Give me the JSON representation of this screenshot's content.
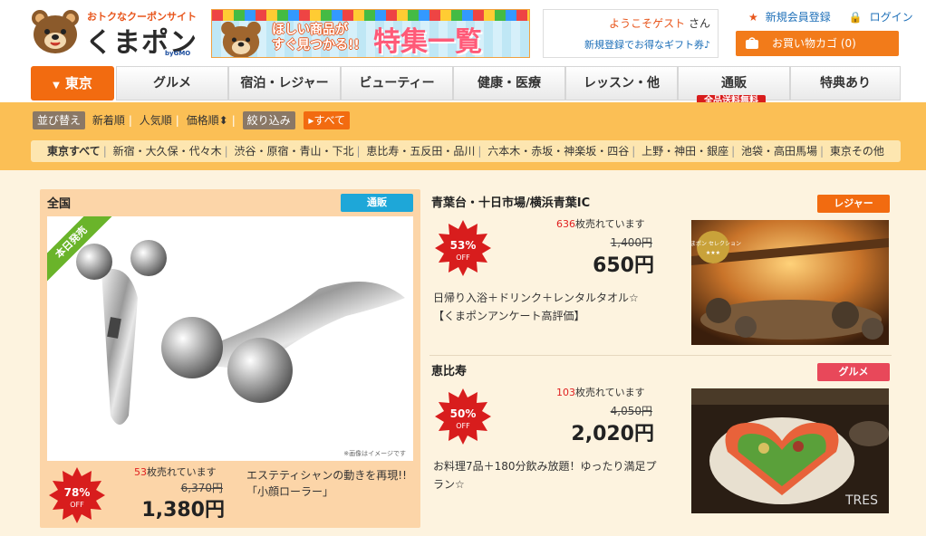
{
  "header": {
    "logo": {
      "tagline": "おトクなクーポンサイト",
      "brand": "くまポン",
      "by": "byGMO"
    },
    "banner": {
      "line1": "ほしい商品が",
      "line2": "すぐ見つかる!!",
      "main": "特集一覧"
    },
    "welcome": {
      "greeting": "ようこそゲスト",
      "suffix": "さん",
      "gift": "新規登録でお得なギフト券♪"
    },
    "links": {
      "register": "新規会員登録",
      "login": "ログイン"
    },
    "cart": {
      "label": "お買い物カゴ (0)"
    }
  },
  "nav": {
    "area": "東京",
    "tabs": [
      "グルメ",
      "宿泊・レジャー",
      "ビューティー",
      "健康・医療",
      "レッスン・他",
      "通販",
      "特典あり"
    ],
    "badge": "全品送料無料"
  },
  "filters": {
    "sort_label": "並び替え",
    "sorts": [
      "新着順",
      "人気順",
      "価格順"
    ],
    "narrow_label": "絞り込み",
    "all_label": "すべて",
    "areas": [
      "東京すべて",
      "新宿・大久保・代々木",
      "渋谷・原宿・青山・下北",
      "恵比寿・五反田・品川",
      "六本木・赤坂・神楽坂・四谷",
      "上野・神田・銀座",
      "池袋・高田馬場",
      "東京その他"
    ]
  },
  "deals": {
    "featured": {
      "region": "全国",
      "category": "通販",
      "ribbon": "本日発売",
      "note": "※画像はイメージです",
      "discount": "78%",
      "off": "OFF",
      "sold_count": "53",
      "sold_suffix": "枚売れています",
      "original_price": "6,370円",
      "price": "1,380円",
      "description": "エステティシャンの動きを再現!!「小顔ローラー」",
      "colors": {
        "tag": "#1ea7d8"
      }
    },
    "items": [
      {
        "region": "青葉台・十日市場/横浜青葉IC",
        "category": "レジャー",
        "discount": "53%",
        "off": "OFF",
        "sold_count": "636",
        "sold_suffix": "枚売れています",
        "original_price": "1,400円",
        "price": "650円",
        "description": "日帰り入浴＋ドリンク＋レンタルタオル☆【くまポンアンケート高評価】",
        "seal": "くまポン セレクション",
        "colors": {
          "tag": "#f26b10"
        }
      },
      {
        "region": "恵比寿",
        "category": "グルメ",
        "discount": "50%",
        "off": "OFF",
        "sold_count": "103",
        "sold_suffix": "枚売れています",
        "original_price": "4,050円",
        "price": "2,020円",
        "description": "お料理7品＋180分飲み放題！ゆったり満足プラン☆",
        "sign": "TRES",
        "colors": {
          "tag": "#e8485a"
        }
      }
    ]
  }
}
